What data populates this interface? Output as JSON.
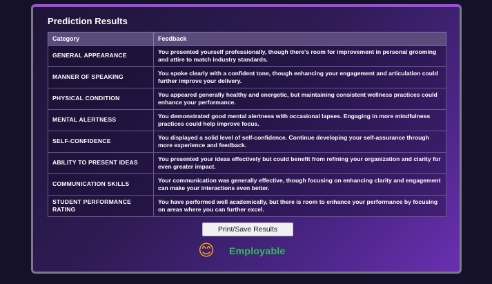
{
  "panel": {
    "title": "Prediction Results"
  },
  "table": {
    "headers": [
      "Category",
      "Feedback"
    ],
    "rows": [
      {
        "category": "GENERAL APPEARANCE",
        "feedback": "You presented yourself professionally, though there's room for improvement in personal grooming and attire to match industry standards."
      },
      {
        "category": "MANNER OF SPEAKING",
        "feedback": "You spoke clearly with a confident tone, though enhancing your engagement and articulation could further improve your delivery."
      },
      {
        "category": "PHYSICAL CONDITION",
        "feedback": "You appeared generally healthy and energetic, but maintaining consistent wellness practices could enhance your performance."
      },
      {
        "category": "MENTAL ALERTNESS",
        "feedback": "You demonstrated good mental alertness with occasional lapses. Engaging in more mindfulness practices could help improve focus."
      },
      {
        "category": "SELF-CONFIDENCE",
        "feedback": "You displayed a solid level of self-confidence. Continue developing your self-assurance through more experience and feedback."
      },
      {
        "category": "ABILITY TO PRESENT IDEAS",
        "feedback": "You presented your ideas effectively but could benefit from refining your organization and clarity for even greater impact."
      },
      {
        "category": "COMMUNICATION SKILLS",
        "feedback": "Your communication was generally effective, though focusing on enhancing clarity and engagement can make your interactions even better."
      },
      {
        "category": "STUDENT PERFORMANCE RATING",
        "feedback": "You have performed well academically, but there is room to enhance your performance by focusing on areas where you can further excel."
      }
    ]
  },
  "actions": {
    "print_save_label": "Print/Save Results"
  },
  "result": {
    "icon": "smiling-face-icon",
    "emoji": "😊",
    "label": "Employable",
    "color": "#2fc25a"
  },
  "colors": {
    "page_background": "#16112b",
    "header_row": "#5b4a7c",
    "accent_border": "#9a4fd8"
  }
}
